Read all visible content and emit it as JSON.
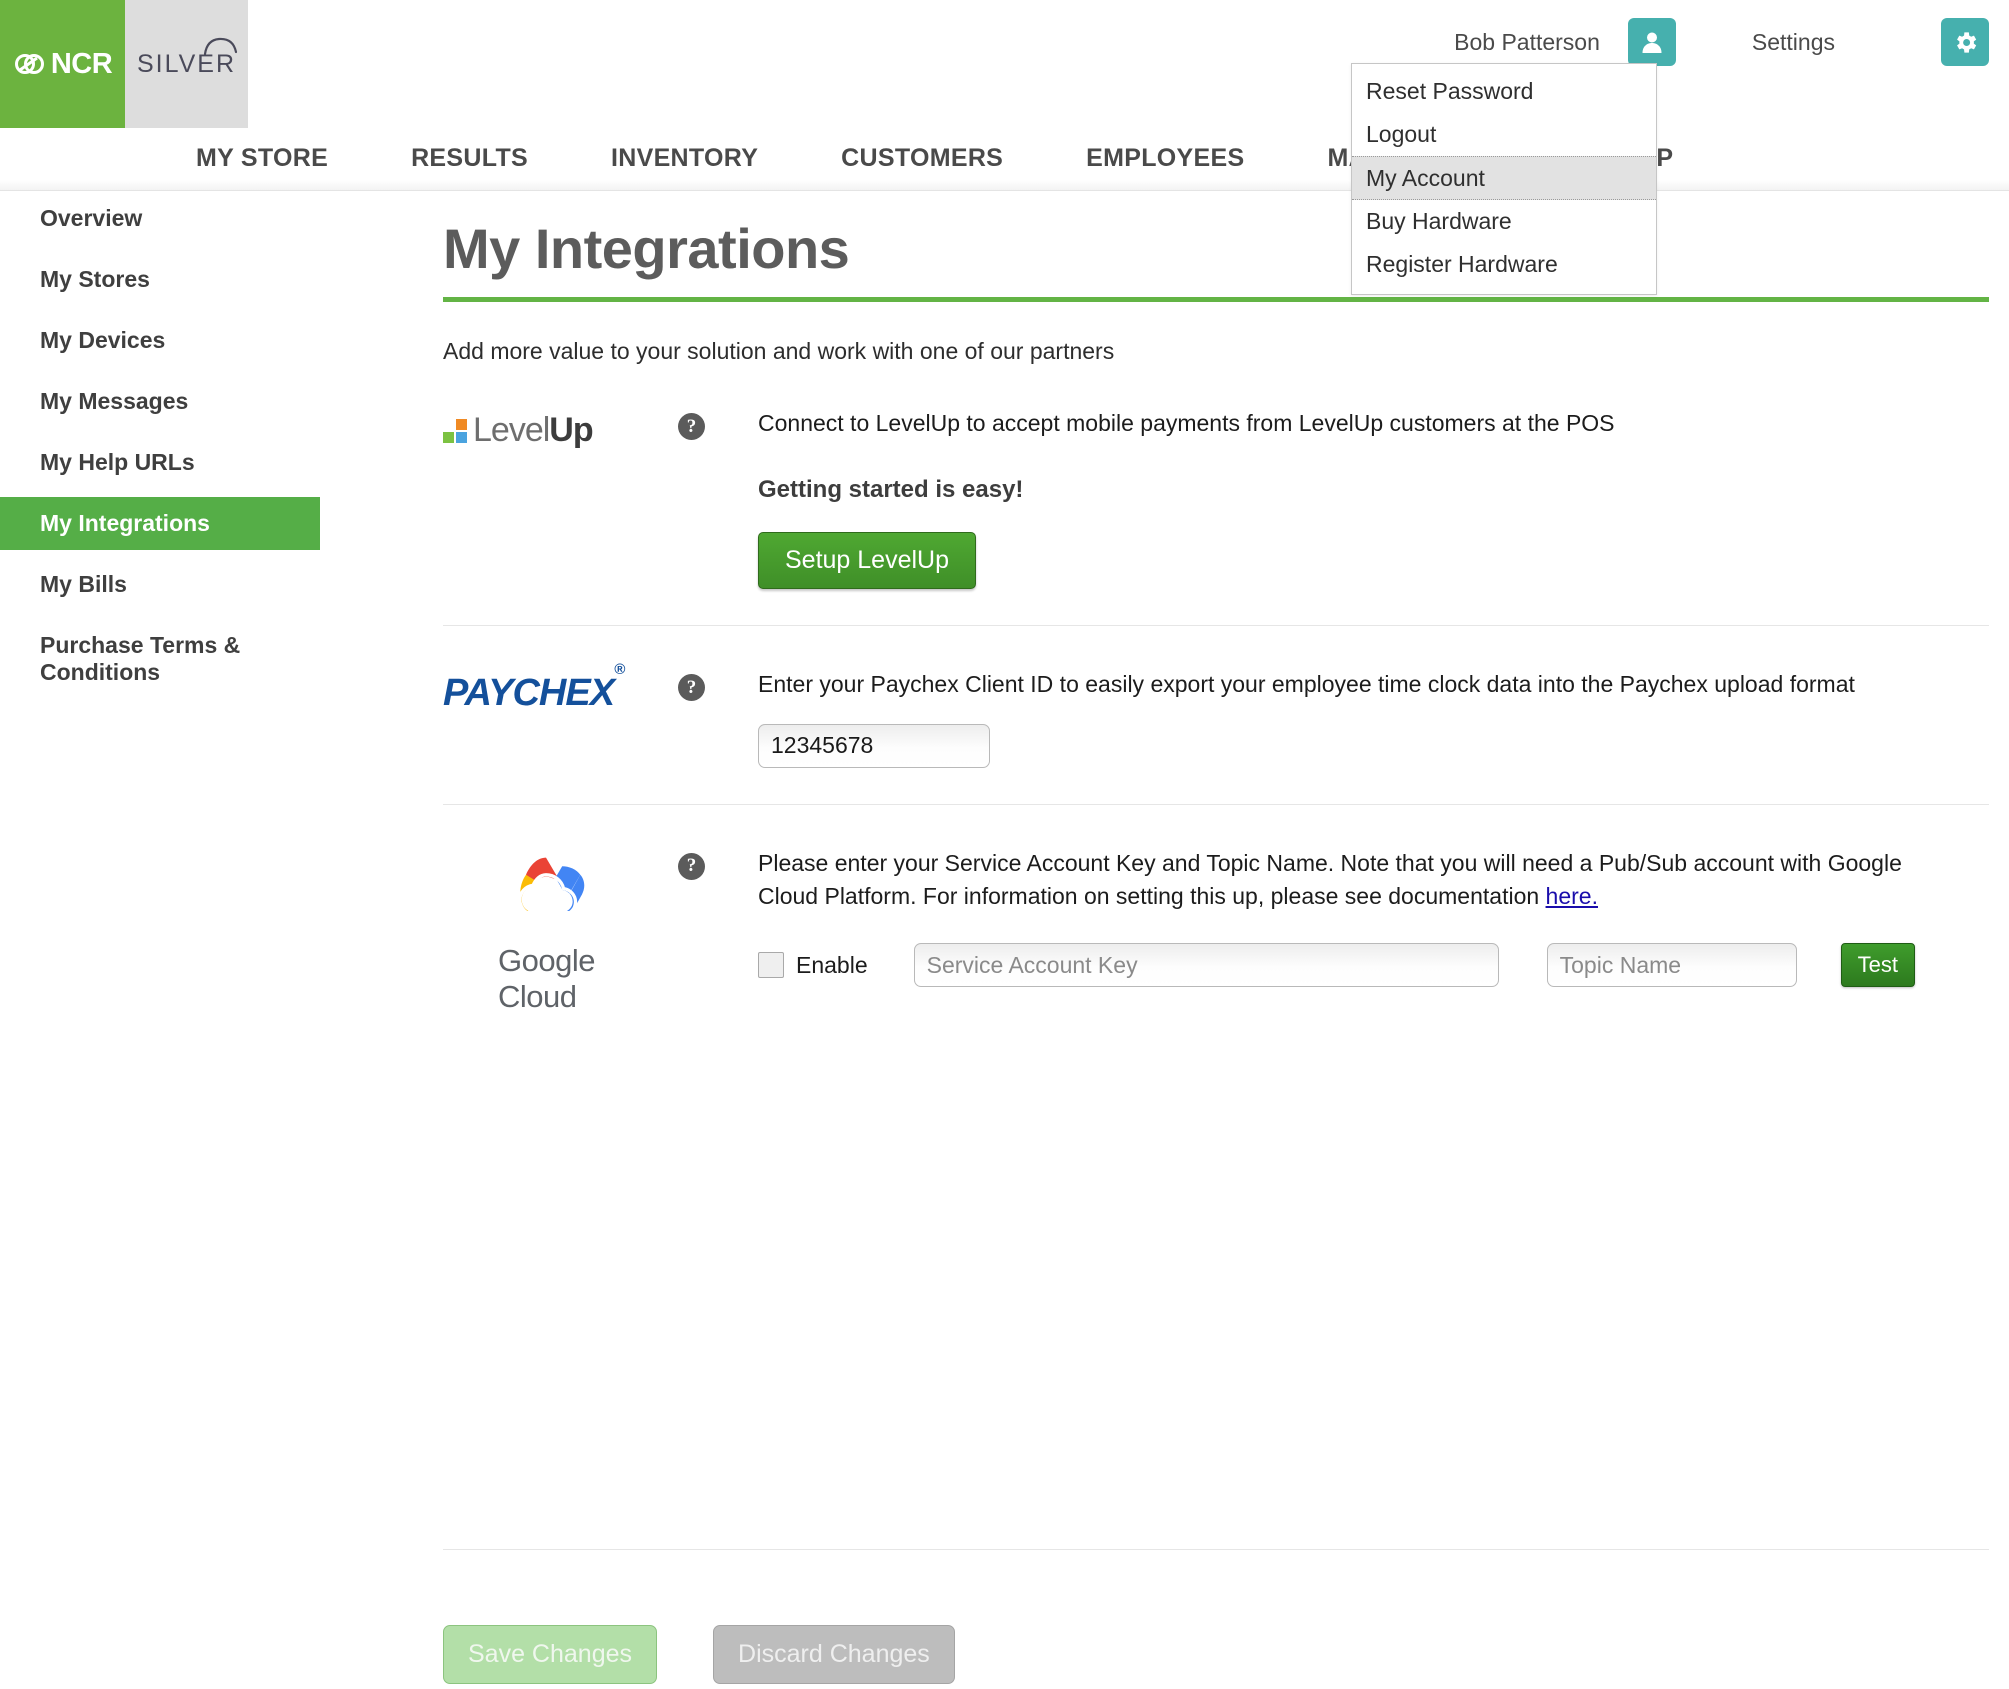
{
  "brand": {
    "ncr_label": "NCR",
    "silver_label": "SILVER",
    "green": "#6cb33f",
    "teal": "#46b0ae"
  },
  "header": {
    "user_name": "Bob Patterson",
    "settings_label": "Settings",
    "user_icon": "person-icon",
    "settings_icon": "gear-icon"
  },
  "nav": {
    "items": [
      {
        "label": "MY STORE"
      },
      {
        "label": "RESULTS"
      },
      {
        "label": "INVENTORY"
      },
      {
        "label": "CUSTOMERS"
      },
      {
        "label": "EMPLOYEES"
      },
      {
        "label": "MARKETPLACE"
      },
      {
        "label": "HELP"
      }
    ]
  },
  "user_dropdown": {
    "items": [
      {
        "label": "Reset Password",
        "active": false
      },
      {
        "label": "Logout",
        "active": false
      },
      {
        "label": "My Account",
        "active": true
      },
      {
        "label": "Buy Hardware",
        "active": false
      },
      {
        "label": "Register Hardware",
        "active": false
      }
    ]
  },
  "sidebar": {
    "items": [
      {
        "label": "Overview",
        "active": false
      },
      {
        "label": "My Stores",
        "active": false
      },
      {
        "label": "My Devices",
        "active": false
      },
      {
        "label": "My Messages",
        "active": false
      },
      {
        "label": "My Help URLs",
        "active": false
      },
      {
        "label": "My Integrations",
        "active": true
      },
      {
        "label": "My Bills",
        "active": false
      },
      {
        "label": "Purchase Terms & Conditions",
        "active": false
      }
    ]
  },
  "main": {
    "title": "My Integrations",
    "subtitle": "Add more value to your solution and work with one of our partners",
    "help_glyph": "?"
  },
  "levelup": {
    "logo_level": "Level",
    "logo_up": "Up",
    "description": "Connect to LevelUp to accept mobile payments from LevelUp customers at the POS",
    "getting_started": "Getting started is easy!",
    "setup_button": "Setup LevelUp"
  },
  "paychex": {
    "logo_text": "PAYCHEX",
    "logo_mark": "®",
    "description": "Enter your Paychex Client ID to easily export your employee time clock data into the Paychex upload format",
    "client_id_value": "12345678",
    "client_id_placeholder": ""
  },
  "google_cloud": {
    "logo_text": "Google Cloud",
    "description_line1": "Please enter your Service Account Key and Topic Name. Note that you will need a Pub/Sub account with Google",
    "description_line2_pre": "Cloud Platform. For information on setting this up, please see documentation ",
    "description_link": "here.",
    "enable_label": "Enable",
    "enable_checked": false,
    "service_key_placeholder": "Service Account Key",
    "service_key_value": "",
    "topic_placeholder": "Topic Name",
    "topic_value": "",
    "test_button": "Test"
  },
  "footer": {
    "save_label": "Save Changes",
    "discard_label": "Discard Changes"
  }
}
